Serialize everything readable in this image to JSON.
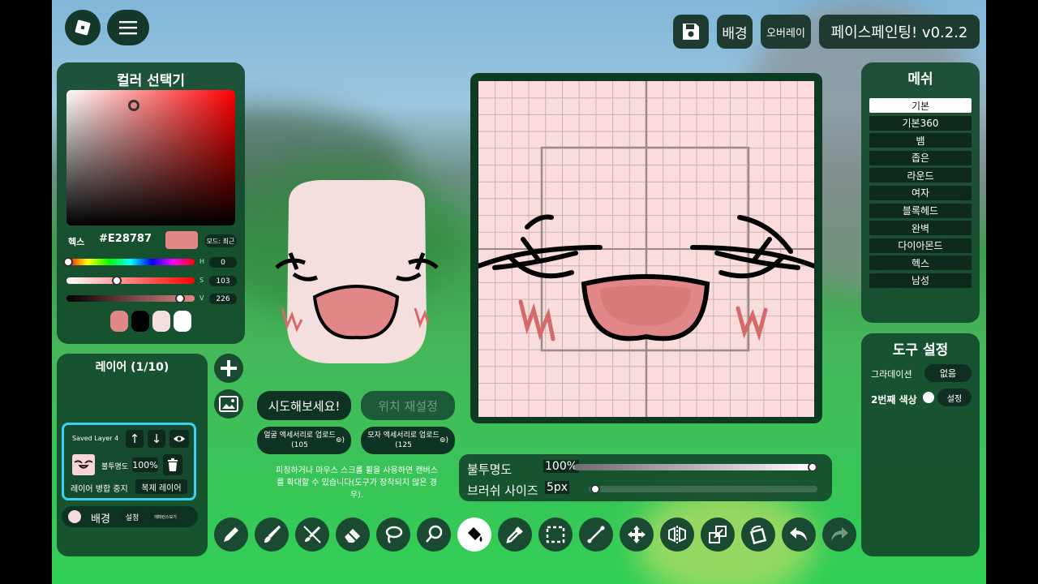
{
  "header": {
    "background_button": "배경",
    "overlay_button": "오버레이",
    "app_title": "페이스페인팅! v0.2.2"
  },
  "color_picker": {
    "title": "컬러 선택기",
    "hex_label": "헥스",
    "hex_value": "#E28787",
    "mode_label": "모드: 최근",
    "h_label": "H",
    "h_value": "0",
    "s_label": "S",
    "s_value": "103",
    "v_label": "V",
    "v_value": "226",
    "swatches": [
      "#e28787",
      "#000000",
      "#f7dede",
      "#ffffff"
    ]
  },
  "layers": {
    "title": "레이어 (1/10)",
    "layer_name": "Saved Layer 4",
    "opacity_label": "불투명도",
    "opacity_value": "100%",
    "merge_label": "레이어 병합 중지",
    "duplicate_label": "복제 레이어",
    "background_label": "배경",
    "settings_label": "설정",
    "reference_label": "레퍼런스보기"
  },
  "actions": {
    "try_button": "시도해보세요!",
    "reset_position_button": "위치 재설정",
    "face_upload": "얼굴 액세서리로 업로드 (105",
    "hat_upload": "모자 액세서리로 업로드 (125",
    "hint": "피칭하거나 마우스 스크롤 휠을 사용하면 캔버스를 확대할 수 있습니다(도구가 장착되지 않은 경우)."
  },
  "brush": {
    "opacity_label": "불투명도",
    "opacity_value": "100%",
    "size_label": "브러쉬 사이즈",
    "size_value": "5px"
  },
  "mesh": {
    "title": "메쉬",
    "items": [
      "기본",
      "기본360",
      "뱀",
      "좁은",
      "라운드",
      "여자",
      "블록헤드",
      "완벽",
      "다이아몬드",
      "헥스",
      "남성"
    ],
    "selected": "기본"
  },
  "tool_settings": {
    "title": "도구 설정",
    "gradient_label": "그라데이션",
    "gradient_value": "없음",
    "second_color_label": "2번째 색상",
    "settings_label": "설정"
  },
  "tools": [
    "pencil-icon",
    "brush-icon",
    "eraser-brush-icon",
    "eraser-icon",
    "lasso-icon",
    "magic-lasso-icon",
    "fill-bucket-icon",
    "eyedropper-icon",
    "select-rect-icon",
    "line-icon",
    "move-icon",
    "mirror-icon",
    "resize-icon",
    "rotate-icon",
    "undo-icon",
    "redo-icon"
  ],
  "colors": {
    "accent": "#e28787",
    "panel": "#144a2c",
    "selected_outline": "#3ad0f0"
  }
}
